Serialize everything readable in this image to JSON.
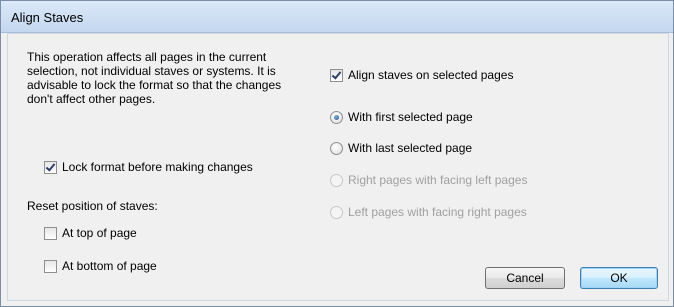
{
  "window": {
    "title": "Align Staves"
  },
  "description": "This operation affects all pages in the current selection, not individual staves or systems. It is advisable to lock the format so that the changes don't affect other pages.",
  "lock_format": {
    "label": "Lock format before making changes",
    "checked": true
  },
  "reset_position": {
    "heading": "Reset position of staves:",
    "options": [
      {
        "label": "At top of page",
        "checked": false
      },
      {
        "label": "At bottom of page",
        "checked": false
      }
    ]
  },
  "align_selected": {
    "label": "Align staves on selected pages",
    "checked": true
  },
  "align_with": [
    {
      "label": "With first selected page",
      "selected": true,
      "enabled": true
    },
    {
      "label": "With last selected page",
      "selected": false,
      "enabled": true
    },
    {
      "label": "Right pages with facing left pages",
      "selected": false,
      "enabled": false
    },
    {
      "label": "Left pages with facing right pages",
      "selected": false,
      "enabled": false
    }
  ],
  "buttons": {
    "cancel": "Cancel",
    "ok": "OK"
  }
}
